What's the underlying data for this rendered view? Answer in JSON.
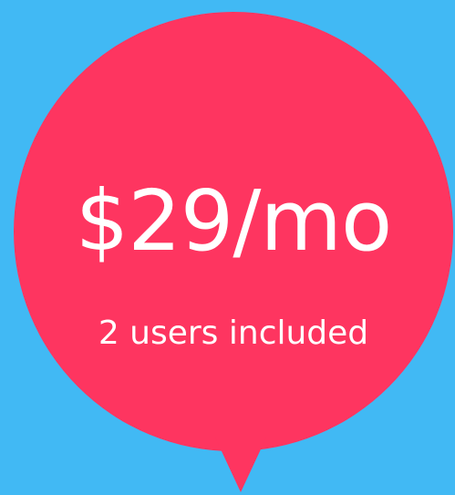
{
  "pricing": {
    "price": "$29/mo",
    "users_label": "2 users included"
  },
  "colors": {
    "background": "#41b9f4",
    "bubble": "#fe3560",
    "text": "#ffffff"
  }
}
